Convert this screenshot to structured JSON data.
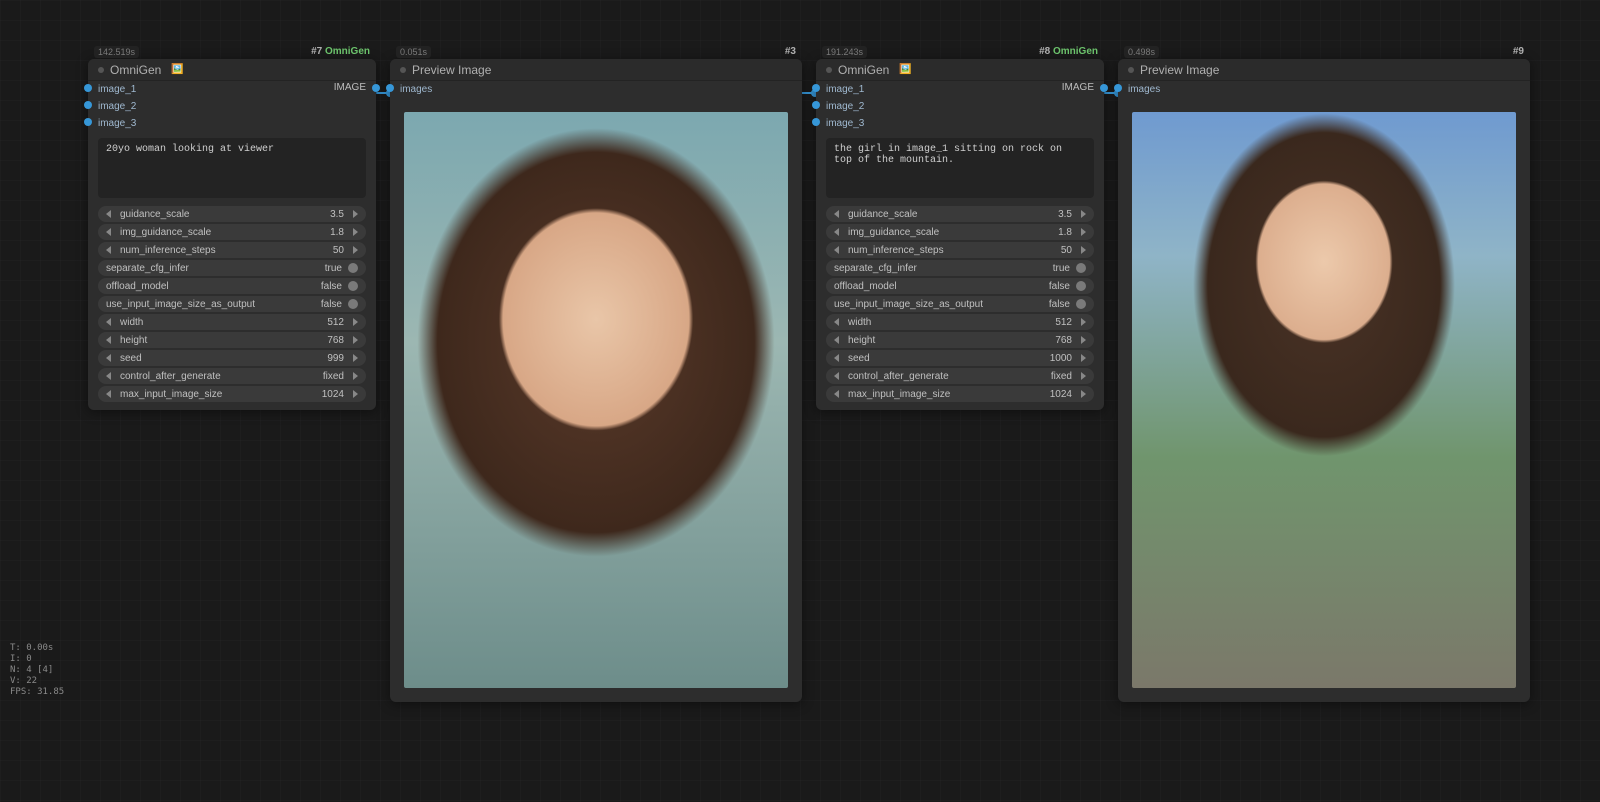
{
  "stats": {
    "t": "T: 0.00s",
    "i": "I: 0",
    "n": "N: 4 [4]",
    "v": "V: 22",
    "fps": "FPS: 31.85"
  },
  "node1": {
    "time": "142.519s",
    "id_num": "#7 ",
    "id_name": "OmniGen",
    "title": "OmniGen",
    "icon": "🖼️",
    "inputs": [
      "image_1",
      "image_2",
      "image_3"
    ],
    "output": "IMAGE",
    "prompt": "20yo woman looking at viewer",
    "params": [
      {
        "k": "guidance_scale",
        "v": "3.5"
      },
      {
        "k": "img_guidance_scale",
        "v": "1.8"
      },
      {
        "k": "num_inference_steps",
        "v": "50"
      }
    ],
    "toggles": [
      {
        "k": "separate_cfg_infer",
        "v": "true"
      },
      {
        "k": "offload_model",
        "v": "false"
      },
      {
        "k": "use_input_image_size_as_output",
        "v": "false"
      }
    ],
    "params2": [
      {
        "k": "width",
        "v": "512"
      },
      {
        "k": "height",
        "v": "768"
      },
      {
        "k": "seed",
        "v": "999"
      },
      {
        "k": "control_after_generate",
        "v": "fixed"
      },
      {
        "k": "max_input_image_size",
        "v": "1024"
      }
    ]
  },
  "node2": {
    "time": "0.051s",
    "id_num": "#3",
    "title": "Preview Image",
    "input": "images"
  },
  "node3": {
    "time": "191.243s",
    "id_num": "#8 ",
    "id_name": "OmniGen",
    "title": "OmniGen",
    "icon": "🖼️",
    "inputs": [
      "image_1",
      "image_2",
      "image_3"
    ],
    "output": "IMAGE",
    "prompt": "the girl in image_1 sitting on rock on top of the mountain.",
    "params": [
      {
        "k": "guidance_scale",
        "v": "3.5"
      },
      {
        "k": "img_guidance_scale",
        "v": "1.8"
      },
      {
        "k": "num_inference_steps",
        "v": "50"
      }
    ],
    "toggles": [
      {
        "k": "separate_cfg_infer",
        "v": "true"
      },
      {
        "k": "offload_model",
        "v": "false"
      },
      {
        "k": "use_input_image_size_as_output",
        "v": "false"
      }
    ],
    "params2": [
      {
        "k": "width",
        "v": "512"
      },
      {
        "k": "height",
        "v": "768"
      },
      {
        "k": "seed",
        "v": "1000"
      },
      {
        "k": "control_after_generate",
        "v": "fixed"
      },
      {
        "k": "max_input_image_size",
        "v": "1024"
      }
    ]
  },
  "node4": {
    "time": "0.498s",
    "id_num": "#9",
    "title": "Preview Image",
    "input": "images"
  }
}
